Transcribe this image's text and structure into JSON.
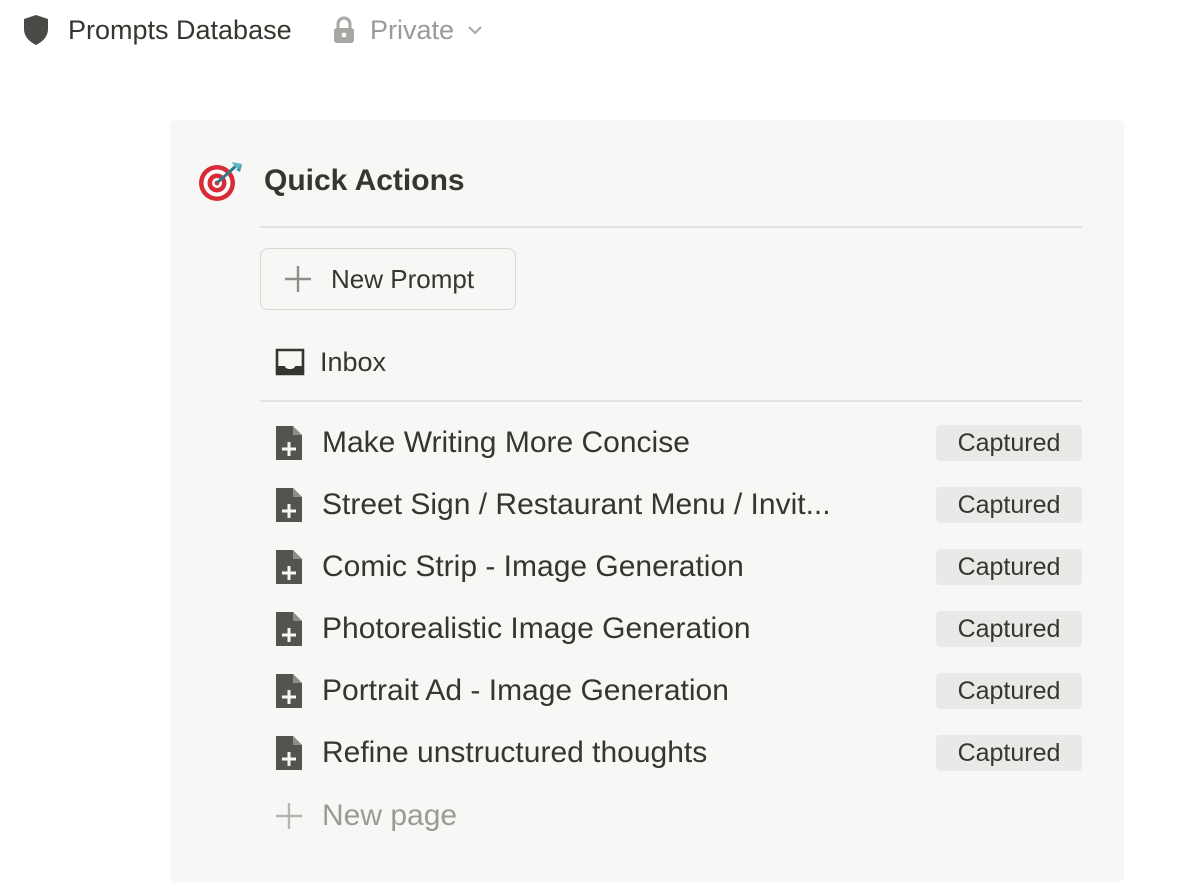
{
  "header": {
    "title": "Prompts Database",
    "privacy_label": "Private",
    "icon": "shield-icon"
  },
  "quick_actions": {
    "heading": "Quick Actions",
    "icon": "target-icon",
    "new_prompt_label": "New Prompt",
    "inbox_label": "Inbox",
    "items": [
      {
        "title": "Make Writing More Concise",
        "status": "Captured"
      },
      {
        "title": "Street Sign / Restaurant Menu / Invit...",
        "status": "Captured"
      },
      {
        "title": "Comic Strip - Image Generation",
        "status": "Captured"
      },
      {
        "title": "Photorealistic Image Generation",
        "status": "Captured"
      },
      {
        "title": "Portrait Ad - Image Generation",
        "status": "Captured"
      },
      {
        "title": "Refine unstructured thoughts",
        "status": "Captured"
      }
    ],
    "new_page_label": "New page"
  },
  "colors": {
    "text": "#37352f",
    "muted": "#9b9a97",
    "card_bg": "#f7f7f5",
    "badge_bg": "#e9e9e7",
    "icon": "#55534e"
  }
}
